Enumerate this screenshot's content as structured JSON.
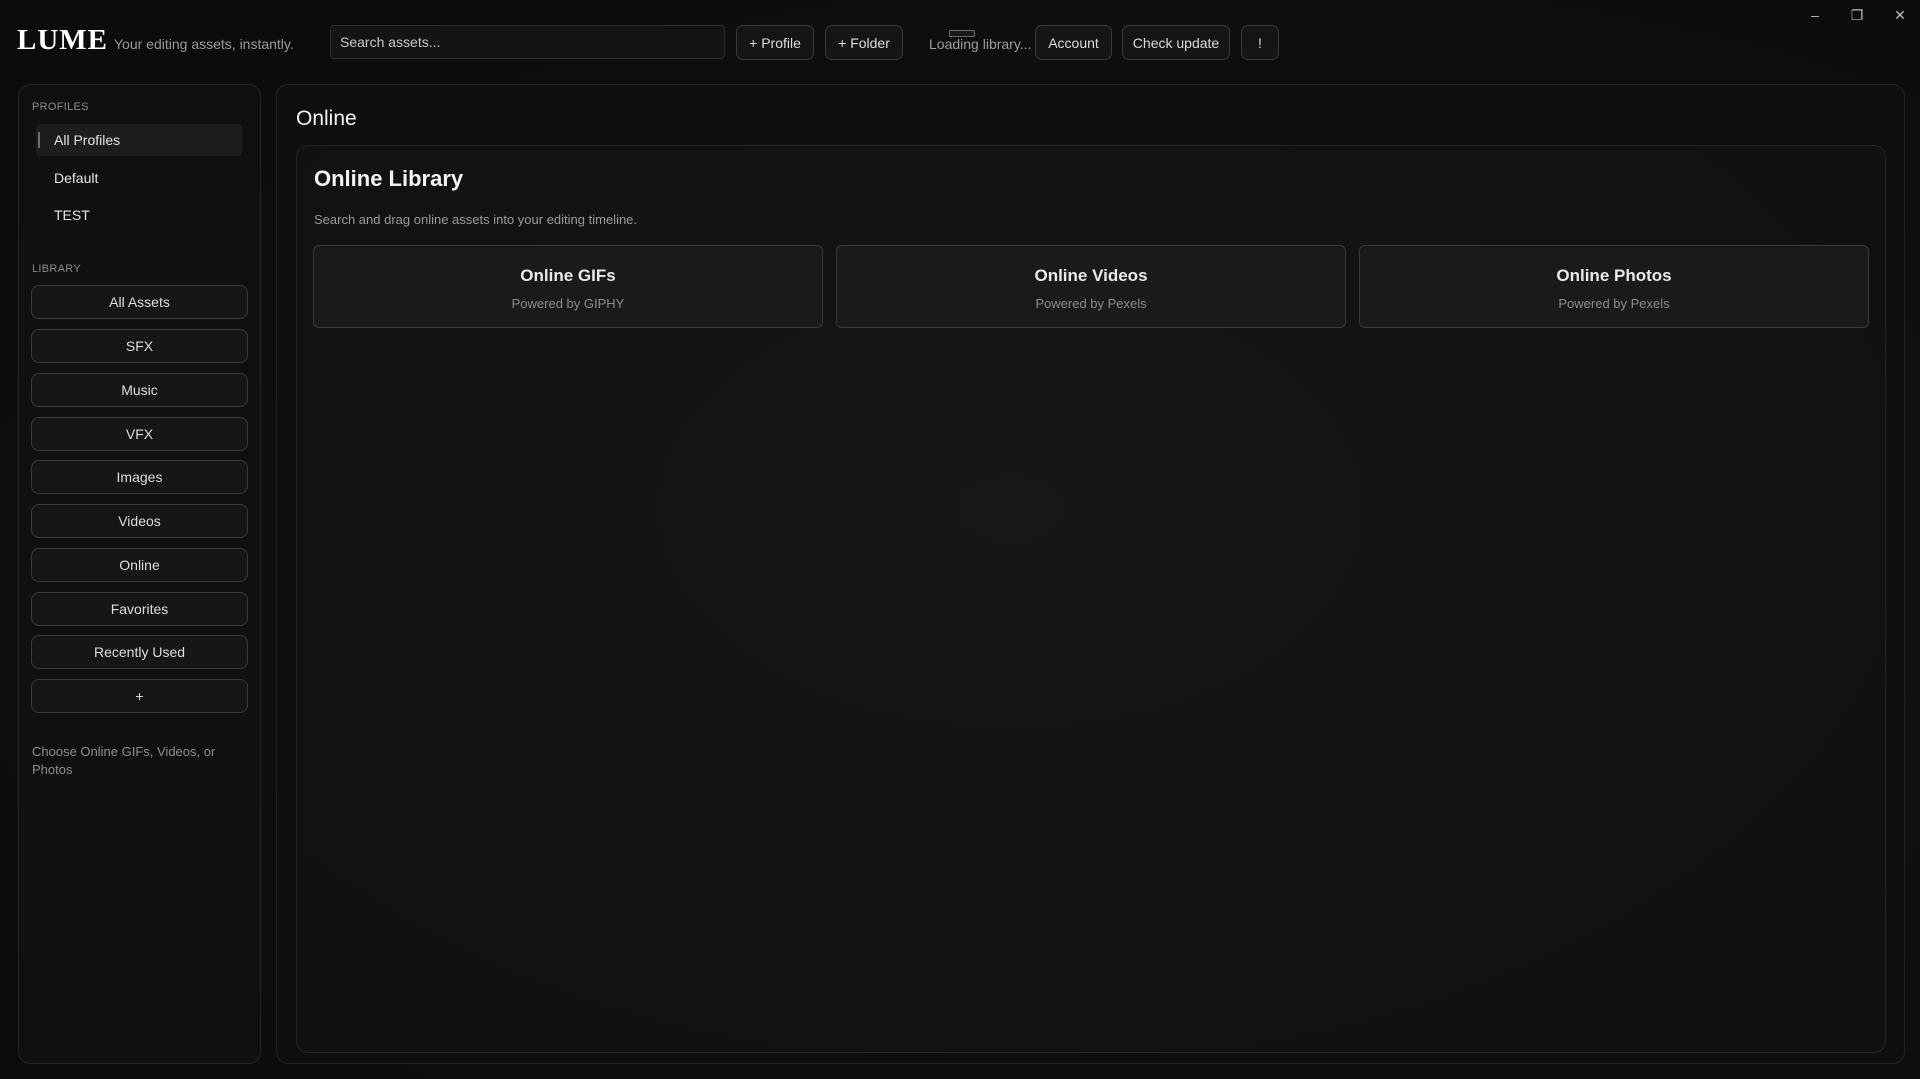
{
  "app": {
    "logo": "LUME",
    "tagline": "Your editing assets, instantly."
  },
  "toolbar": {
    "search_placeholder": "Search assets...",
    "add_profile": "+ Profile",
    "add_folder": "+ Folder",
    "status": "Loading library...",
    "account": "Account",
    "check_update": "Check update",
    "alert": "!"
  },
  "window_controls": {
    "minimize": "–",
    "maximize": "❐",
    "close": "✕"
  },
  "sidebar": {
    "profiles_label": "PROFILES",
    "profiles": [
      {
        "label": "All Profiles",
        "active": true
      },
      {
        "label": "Default",
        "active": false
      },
      {
        "label": "TEST",
        "active": false
      }
    ],
    "library_label": "LIBRARY",
    "library": [
      "All Assets",
      "SFX",
      "Music",
      "VFX",
      "Images",
      "Videos",
      "Online",
      "Favorites",
      "Recently Used",
      "+"
    ],
    "hint": "Choose Online GIFs, Videos, or Photos"
  },
  "main": {
    "title": "Online",
    "panel": {
      "title": "Online Library",
      "description": "Search and drag online assets into your editing timeline.",
      "cards": [
        {
          "title": "Online GIFs",
          "subtitle": "Powered by GIPHY"
        },
        {
          "title": "Online Videos",
          "subtitle": "Powered by Pexels"
        },
        {
          "title": "Online Photos",
          "subtitle": "Powered by Pexels"
        }
      ]
    }
  }
}
